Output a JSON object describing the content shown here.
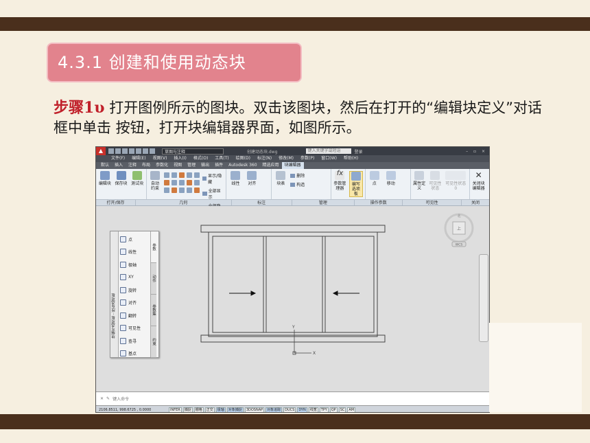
{
  "slide": {
    "section_title": "4.3.1   创建和使用动态块",
    "step_label": "步骤1υ",
    "step_text": " 打开图例所示的图块。双击该图块，然后在打开的“编辑块定义”对话框中单击 按钮，打开块编辑器界面，如图所示。",
    "colors": {
      "band": "#4a2f1c",
      "title_bg": "#e2838d",
      "step_label": "#c0202a",
      "background": "#f6efe0"
    }
  },
  "cad": {
    "titlebar": {
      "workspace": "草图与注释",
      "document_title": "创建动态块.dwg",
      "search_placeholder": "键入关键字或短语",
      "login": "登录"
    },
    "menu": [
      "文件(F)",
      "编辑(E)",
      "视图(V)",
      "插入(I)",
      "格式(O)",
      "工具(T)",
      "绘图(D)",
      "标注(N)",
      "修改(M)",
      "参数(P)",
      "窗口(W)",
      "帮助(H)"
    ],
    "ribbon_tabs": [
      "默认",
      "插入",
      "注释",
      "布局",
      "参数化",
      "视图",
      "管理",
      "输出",
      "插件",
      "Autodesk 360",
      "精选应用",
      "块编辑器"
    ],
    "active_tab": "块编辑器",
    "ribbon": {
      "open_save": [
        "编辑块",
        "保存块",
        "测试块",
        "自动约束"
      ],
      "display": [
        "显示/隐藏",
        "全部显示",
        "全部隐藏"
      ],
      "dimension": [
        "线性",
        "对齐"
      ],
      "block_table": "块表",
      "attribute": [
        "删除",
        "构造"
      ],
      "management": [
        "参数管理器",
        "编写选项板"
      ],
      "action_params": [
        "点",
        "移动"
      ],
      "attribute_def": "属性定义",
      "visibility": [
        "可见性状态",
        "可见性状态0"
      ],
      "close": "关闭块编辑器"
    },
    "panel_labels": [
      "打开/保存",
      "几何",
      "标注",
      "管理",
      "操作参数",
      "可见性",
      "关闭"
    ],
    "palette": {
      "title": "块编写选项板 - 所有选项板",
      "items": [
        "点",
        "线性",
        "极轴",
        "XY",
        "旋转",
        "对齐",
        "翻转",
        "可见性",
        "查寻",
        "基点"
      ],
      "tabs": [
        "参数",
        "动作",
        "参数集",
        "约束"
      ]
    },
    "viewcube": {
      "top_label": "北",
      "center_label": "上",
      "bottom_label": "WCS"
    },
    "command_placeholder": "键入命令",
    "status": {
      "coords": "2106.8511,  998.6725 , 0.0000",
      "toggles": [
        "INFER",
        "捕捉",
        "栅格",
        "正交",
        "极轴",
        "对象捕捉",
        "3DOSNAP",
        "对象追踪",
        "DUCS",
        "DYN",
        "线宽",
        "TPY",
        "QP",
        "SC",
        "AM"
      ]
    }
  }
}
